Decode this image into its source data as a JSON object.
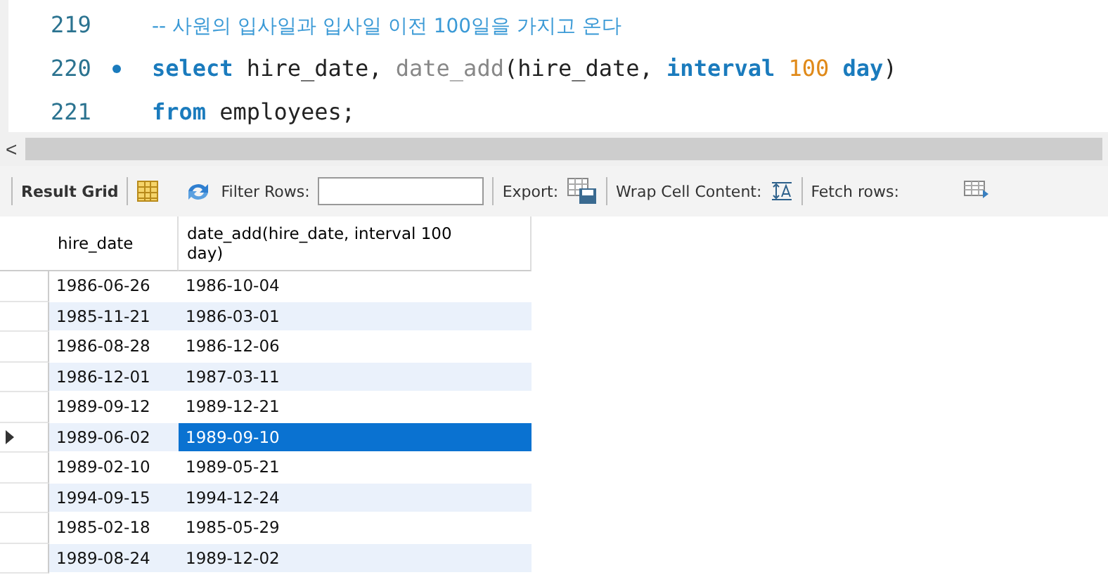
{
  "editor": {
    "lines": [
      {
        "number": "219",
        "marked": false,
        "tokens": [
          {
            "kind": "comment",
            "text": "-- 사원의 입사일과 입사일 이전 100일을 가지고 온다"
          }
        ]
      },
      {
        "number": "220",
        "marked": true,
        "tokens": [
          {
            "kind": "keyword",
            "text": "select"
          },
          {
            "kind": "plain",
            "text": " hire_date, "
          },
          {
            "kind": "function",
            "text": "date_add"
          },
          {
            "kind": "plain",
            "text": "(hire_date, "
          },
          {
            "kind": "keyword",
            "text": "interval"
          },
          {
            "kind": "number",
            "text": " 100 "
          },
          {
            "kind": "keyword",
            "text": "day"
          },
          {
            "kind": "plain",
            "text": ")"
          }
        ]
      },
      {
        "number": "221",
        "marked": false,
        "tokens": [
          {
            "kind": "keyword",
            "text": "from"
          },
          {
            "kind": "plain",
            "text": " employees;"
          }
        ]
      }
    ]
  },
  "scroll_arrow": "<",
  "toolbar": {
    "result_grid": "Result Grid",
    "filter_label": "Filter Rows:",
    "export_label": "Export:",
    "wrap_label": "Wrap Cell Content:",
    "fetch_label": "Fetch rows:"
  },
  "table": {
    "columns": [
      "hire_date",
      "date_add(hire_date, interval 100 day)"
    ],
    "rows": [
      {
        "selected": false,
        "cells": [
          {
            "text": "1986-06-26",
            "selected": false
          },
          {
            "text": "1986-10-04",
            "selected": false
          }
        ]
      },
      {
        "selected": false,
        "cells": [
          {
            "text": "1985-11-21",
            "selected": false
          },
          {
            "text": "1986-03-01",
            "selected": false
          }
        ]
      },
      {
        "selected": false,
        "cells": [
          {
            "text": "1986-08-28",
            "selected": false
          },
          {
            "text": "1986-12-06",
            "selected": false
          }
        ]
      },
      {
        "selected": false,
        "cells": [
          {
            "text": "1986-12-01",
            "selected": false
          },
          {
            "text": "1987-03-11",
            "selected": false
          }
        ]
      },
      {
        "selected": false,
        "cells": [
          {
            "text": "1989-09-12",
            "selected": false
          },
          {
            "text": "1989-12-21",
            "selected": false
          }
        ]
      },
      {
        "selected": true,
        "cells": [
          {
            "text": "1989-06-02",
            "selected": false
          },
          {
            "text": "1989-09-10",
            "selected": true
          }
        ]
      },
      {
        "selected": false,
        "cells": [
          {
            "text": "1989-02-10",
            "selected": false
          },
          {
            "text": "1989-05-21",
            "selected": false
          }
        ]
      },
      {
        "selected": false,
        "cells": [
          {
            "text": "1994-09-15",
            "selected": false
          },
          {
            "text": "1994-12-24",
            "selected": false
          }
        ]
      },
      {
        "selected": false,
        "cells": [
          {
            "text": "1985-02-18",
            "selected": false
          },
          {
            "text": "1985-05-29",
            "selected": false
          }
        ]
      },
      {
        "selected": false,
        "cells": [
          {
            "text": "1989-08-24",
            "selected": false
          },
          {
            "text": "1989-12-02",
            "selected": false
          }
        ]
      }
    ]
  }
}
